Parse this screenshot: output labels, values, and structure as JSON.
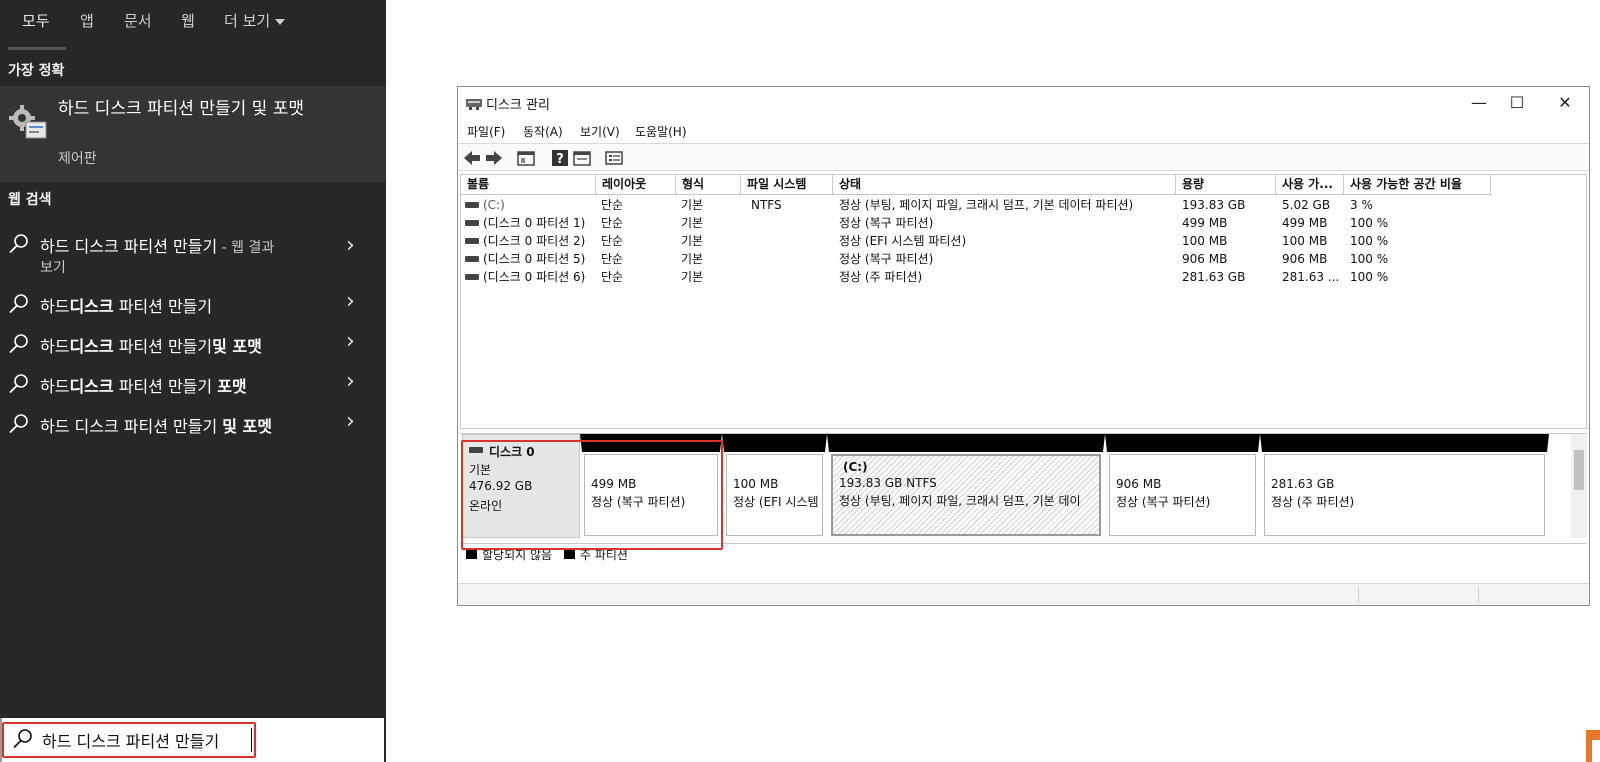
{
  "search_panel": {
    "tabs": [
      {
        "label": "모두",
        "active": true
      },
      {
        "label": "앱"
      },
      {
        "label": "문서"
      },
      {
        "label": "웹"
      },
      {
        "label": "더 보기"
      }
    ],
    "best_match_title": "가장 정확",
    "best_match": {
      "title": "하드 디스크 파티션 만들기 및 포맷",
      "subtitle": "제어판",
      "icon": "control-panel-gear-icon"
    },
    "web_search_title": "웹 검색",
    "web_results": [
      {
        "text": "하드 디스크 파티션 만들기",
        "suffix": " - 웹 결과",
        "sub": "보기"
      },
      {
        "prefix": "하드",
        "bold": "디스크",
        "text": " 파티션 만들기"
      },
      {
        "prefix": "하드",
        "bold": "디스크",
        "text": " 파티션 만들기",
        "bold2": "및 포맷"
      },
      {
        "prefix": "하드",
        "bold": "디스크",
        "text": " 파티션 만들기 ",
        "bold2": "포맷"
      },
      {
        "text": "하드 디스크 파티션 만들기 ",
        "bold2": "및 포멧"
      }
    ],
    "search": {
      "value": "하드 디스크 파티션 만들기",
      "icon": "search-icon"
    },
    "colors": {
      "background": "#272727",
      "highlight": "#d9342b"
    }
  },
  "disk_mgmt": {
    "title": "디스크 관리",
    "window_controls": {
      "minimize": "—",
      "maximize": "☐",
      "close": "✕"
    },
    "menu": [
      "파일(F)",
      "동작(A)",
      "보기(V)",
      "도움말(H)"
    ],
    "toolbar_icons": [
      "back-arrow-icon",
      "forward-arrow-icon",
      "properties-icon",
      "help-icon",
      "refresh-icon",
      "view-icon"
    ],
    "columns": [
      "볼륨",
      "레이아웃",
      "형식",
      "파일 시스템",
      "상태",
      "용량",
      "사용 가...",
      "사용 가능한 공간 비율"
    ],
    "rows": [
      [
        "(C:)",
        "단순",
        "기본",
        "NTFS",
        "정상 (부팅, 페이지 파일, 크래시 덤프, 기본 데이터 파티션)",
        "193.83 GB",
        "5.02 GB",
        "3 %"
      ],
      [
        "(디스크 0 파티션 1)",
        "단순",
        "기본",
        "",
        "정상 (복구 파티션)",
        "499 MB",
        "499 MB",
        "100 %"
      ],
      [
        "(디스크 0 파티션 2)",
        "단순",
        "기본",
        "",
        "정상 (EFI 시스템 파티션)",
        "100 MB",
        "100 MB",
        "100 %"
      ],
      [
        "(디스크 0 파티션 5)",
        "단순",
        "기본",
        "",
        "정상 (복구 파티션)",
        "906 MB",
        "906 MB",
        "100 %"
      ],
      [
        "(디스크 0 파티션 6)",
        "단순",
        "기본",
        "",
        "정상 (주 파티션)",
        "281.63 GB",
        "281.63 ...",
        "100 %"
      ]
    ],
    "disk": {
      "name": "디스크 0",
      "type": "기본",
      "size": "476.92 GB",
      "status": "온라인",
      "partitions": [
        {
          "label": "",
          "size": "499 MB",
          "status": "정상 (복구 파티션)"
        },
        {
          "label": "",
          "size": "100 MB",
          "status": "정상 (EFI 시스템"
        },
        {
          "label": "(C:)",
          "size": "193.83 GB NTFS",
          "status": "정상 (부팅, 페이지 파일, 크래시 덤프, 기본 데이",
          "hatched": true
        },
        {
          "label": "",
          "size": "906 MB",
          "status": "정상 (복구 파티션)"
        },
        {
          "label": "",
          "size": "281.63 GB",
          "status": "정상 (주 파티션)"
        }
      ]
    },
    "legend": [
      "할당되지 않음",
      "주 파티션"
    ]
  }
}
